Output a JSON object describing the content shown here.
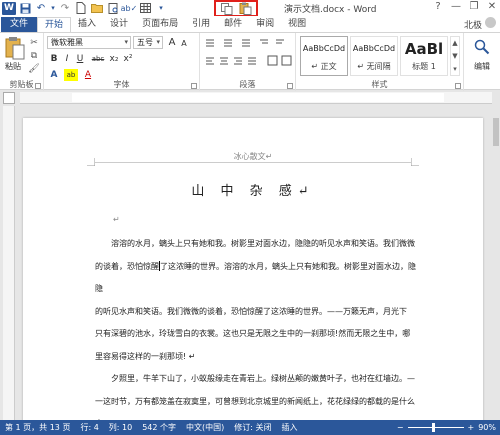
{
  "titlebar": {
    "doc_title": "演示文档.docx - Word",
    "window_controls": [
      "?",
      "—",
      "❐",
      "✕"
    ]
  },
  "tabs": [
    "文件",
    "开始",
    "插入",
    "设计",
    "页面布局",
    "引用",
    "邮件",
    "审阅",
    "视图"
  ],
  "active_tab": "开始",
  "user": "北极",
  "ribbon": {
    "clipboard": {
      "paste_label": "粘贴",
      "group_label": "剪贴板"
    },
    "font": {
      "font_name": "微软雅黑",
      "font_size": "五号",
      "size_up": "A",
      "size_down": "A",
      "bold": "B",
      "italic": "I",
      "underline": "U",
      "strike": "abc",
      "sub": "x₂",
      "sup": "x²",
      "text_effect": "A",
      "highlight": "ab",
      "font_color": "A",
      "group_label": "字体"
    },
    "paragraph": {
      "group_label": "段落"
    },
    "styles": {
      "items": [
        {
          "preview": "AaBbCcDd",
          "name": "↵ 正文"
        },
        {
          "preview": "AaBbCcDd",
          "name": "↵ 无间隔"
        },
        {
          "preview": "AaBl",
          "name": "标题 1"
        }
      ],
      "group_label": "样式"
    },
    "editing": {
      "label": "编辑"
    }
  },
  "document": {
    "header": "冰心散文↵",
    "heading": "山 中 杂 感↵",
    "empty_line": "↵",
    "lines": [
      "　　溶溶的水月，螭头上只有她和我。树影里对面水边，隐隐的听见水声和笑语。我们微微",
      "的谈着，恐怕惊醒了这浓睡的世界。溶溶的水月，螭头上只有她和我。树影里对面水边，隐隐",
      "的听见水声和笑语。我们微微的谈着，恐怕惊醒了这浓睡的世界。——万籁无声，月光下",
      "只有深碧的池水，玲珑雪白的衣裳。这也只是无限之生中的一刹那顷!然而无限之生中，哪",
      "里容易得这样的一刹那顷! ↵",
      "　　夕照里，牛羊下山了，小蚁般缘走在青岩上。绿树丛颠的嫩黄叶子，也衬在红墙边。—",
      "一这时节，万有都笼盖在寂寞里，可曾想到北京城里的新闻纸上，花花绿绿的都载的是什么",
      "事? ↵"
    ]
  },
  "status": {
    "page": "第 1 页，共 13 页",
    "row": "行: 4",
    "col": "列: 10",
    "words": "542 个字",
    "lang": "中文(中国)",
    "track": "修订: 关闭",
    "insert": "插入",
    "zoom": "90%",
    "zoom_level": 0.45
  },
  "colors": {
    "accent": "#2b579a",
    "highlight_border": "#e0201b"
  }
}
